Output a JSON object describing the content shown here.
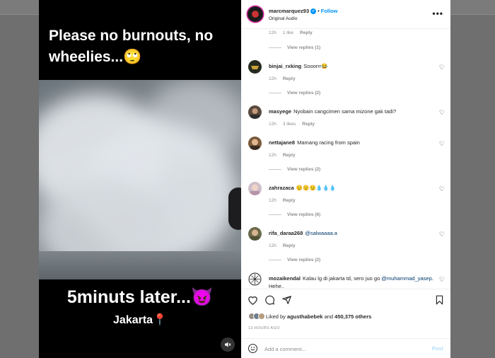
{
  "media": {
    "top_text": "Please no burnouts, no wheelies...🙄",
    "bottom_text": "5minuts later...😈",
    "location": "Jakarta📍",
    "mute_icon": "speaker-muted-icon"
  },
  "header": {
    "username": "marcmarquez93",
    "separator": "•",
    "follow_label": "Follow",
    "audio_label": "Original Audio",
    "more_label": "•••"
  },
  "top_partial": {
    "time": "12h",
    "likes": "1 like",
    "reply": "Reply",
    "view_replies": "View replies (1)"
  },
  "comments": [
    {
      "user": "binjai_rxking",
      "text": "Sooorrr😂",
      "time": "12h",
      "likes": "",
      "reply": "Reply",
      "view_replies": "View replies (2)"
    },
    {
      "user": "masyege",
      "text": "Nyobain cangcimen sama mizone gak tadi?",
      "time": "12h",
      "likes": "3 likes",
      "reply": "Reply",
      "view_replies": ""
    },
    {
      "user": "nettajane8",
      "text": "Mamang racing from spain",
      "time": "12h",
      "likes": "",
      "reply": "Reply",
      "view_replies": "View replies (2)"
    },
    {
      "user": "zahrazaca",
      "text": "😟😟😟💧💧💧",
      "time": "12h",
      "likes": "",
      "reply": "Reply",
      "view_replies": "View replies (6)"
    },
    {
      "user": "rifa_daraa268",
      "text": "",
      "mention": "@salwaaaa.a",
      "time": "12h",
      "likes": "",
      "reply": "Reply",
      "view_replies": "View replies (2)"
    },
    {
      "user": "mozaikendal",
      "text": "Kalau lg di jakarta td, sero juo go",
      "mention": "@muhammad_yasep",
      "text2": ". Hehe..",
      "time": "",
      "likes": "",
      "reply": "",
      "view_replies": ""
    }
  ],
  "actions": {
    "liked_prefix": "Liked by",
    "liked_user": "agusthabebek",
    "liked_and": "and",
    "liked_count": "450,375 others",
    "timestamp": "13 HOURS AGO"
  },
  "add_comment": {
    "placeholder": "Add a comment...",
    "post_label": "Post"
  },
  "colors": {
    "accent": "#0095f6",
    "mention": "#00376b",
    "muted": "#8e8e8e"
  }
}
